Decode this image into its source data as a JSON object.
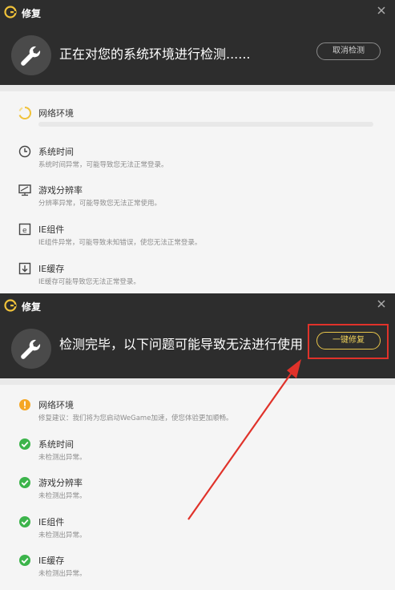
{
  "window_title": "修复",
  "scan_panel": {
    "header_text": "正在对您的系统环境进行检测......",
    "cancel_label": "取消检测",
    "items": [
      {
        "name": "网络环境",
        "desc": "",
        "progress": 0.0
      },
      {
        "name": "系统时间",
        "desc": "系统时间异常，可能导致您无法正常登录。"
      },
      {
        "name": "游戏分辨率",
        "desc": "分辨率异常，可能导致您无法正常使用。"
      },
      {
        "name": "IE组件",
        "desc": "IE组件异常，可能导致未知错误，使您无法正常登录。"
      },
      {
        "name": "IE缓存",
        "desc": "IE缓存可能导致您无法正常登录。"
      }
    ]
  },
  "result_panel": {
    "header_text": "检测完毕，以下问题可能导致无法进行使用",
    "fix_label": "一键修复",
    "items": [
      {
        "name": "网络环境",
        "desc": "修复建议：我们将为您启动WeGame加速，使您体验更加顺畅。",
        "status": "warning"
      },
      {
        "name": "系统时间",
        "desc": "未检测出异常。",
        "status": "ok"
      },
      {
        "name": "游戏分辨率",
        "desc": "未检测出异常。",
        "status": "ok"
      },
      {
        "name": "IE组件",
        "desc": "未检测出异常。",
        "status": "ok"
      },
      {
        "name": "IE缓存",
        "desc": "未检测出异常。",
        "status": "ok"
      }
    ]
  },
  "icons": {
    "logo": "wegame-logo-icon",
    "close": "close-icon",
    "wrench": "wrench-icon",
    "loading": "loading-spinner-icon",
    "clock": "clock-icon",
    "monitor": "monitor-icon",
    "ie": "ie-icon",
    "download": "cache-icon",
    "warning": "warning-icon",
    "check": "check-icon"
  },
  "colors": {
    "titlebar_bg": "#2d2d2d",
    "accent_yellow": "#f0c23a",
    "ok_green": "#3cb44b",
    "warning_orange": "#f5a623",
    "highlight_red": "#e0322a"
  }
}
